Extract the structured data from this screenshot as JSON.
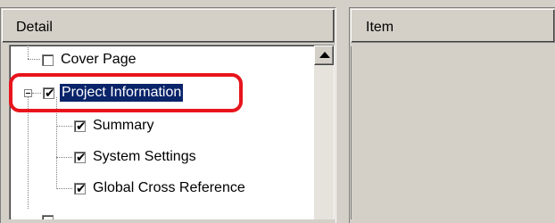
{
  "left_panel": {
    "header": "Detail",
    "tree": [
      {
        "label": "Cover Page",
        "checked": false,
        "icon": "checkbox-unchecked-icon"
      },
      {
        "label": "Project Information",
        "checked": true,
        "selected": true,
        "expanded": true,
        "icon": "checkbox-checked-icon"
      },
      {
        "label": "Summary",
        "checked": true,
        "icon": "checkbox-checked-icon"
      },
      {
        "label": "System Settings",
        "checked": true,
        "icon": "checkbox-checked-icon"
      },
      {
        "label": "Global Cross Reference",
        "checked": true,
        "icon": "checkbox-checked-icon"
      }
    ],
    "scroll_icon": "scroll-up-arrow-icon"
  },
  "right_panel": {
    "header": "Item"
  },
  "colors": {
    "selection_bg": "#0a246a",
    "highlight_ring": "#e8141c",
    "window_bg": "#d4d0c8"
  }
}
